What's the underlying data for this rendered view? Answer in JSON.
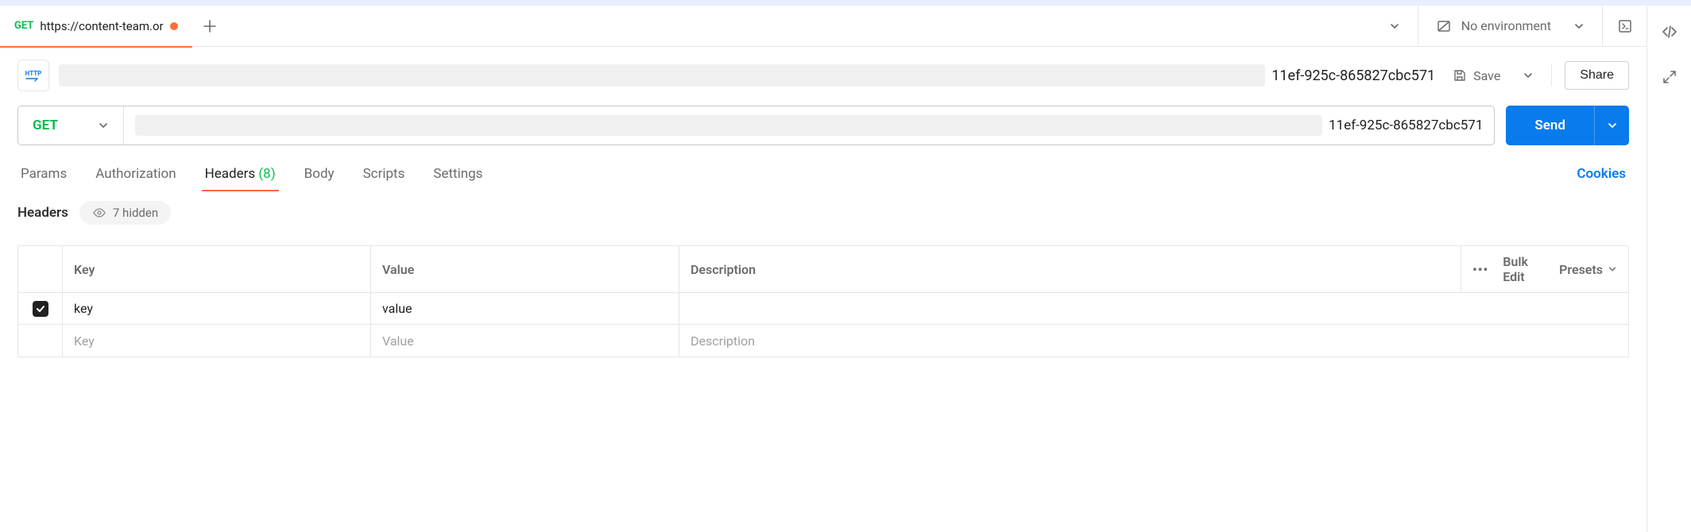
{
  "tab": {
    "method": "GET",
    "title": "https://content-team.or"
  },
  "environment": {
    "label": "No environment"
  },
  "title": {
    "suffix": "11ef-925c-865827cbc571"
  },
  "actions": {
    "save": "Save",
    "share": "Share"
  },
  "request": {
    "method": "GET",
    "url_suffix": "11ef-925c-865827cbc571",
    "send": "Send"
  },
  "subtabs": {
    "params": "Params",
    "authorization": "Authorization",
    "headers": "Headers",
    "headers_count": "(8)",
    "body": "Body",
    "scripts": "Scripts",
    "settings": "Settings",
    "cookies": "Cookies"
  },
  "headers_section": {
    "title": "Headers",
    "hidden_label": "7 hidden"
  },
  "table": {
    "headers": {
      "key": "Key",
      "value": "Value",
      "description": "Description",
      "bulk_edit": "Bulk Edit",
      "presets": "Presets"
    },
    "rows": [
      {
        "checked": true,
        "key": "key",
        "value": "value",
        "description": ""
      }
    ],
    "placeholders": {
      "key": "Key",
      "value": "Value",
      "description": "Description"
    }
  }
}
